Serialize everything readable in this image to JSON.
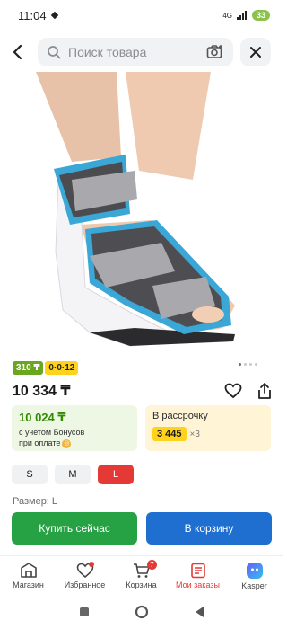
{
  "status": {
    "time": "11:04",
    "network": "4G",
    "battery": "33"
  },
  "search": {
    "placeholder": "Поиск товара"
  },
  "badges": {
    "bonus": "310 ₸",
    "installment": "0·0·12"
  },
  "product": {
    "price": "10 334 ₸"
  },
  "bonus_card": {
    "price": "10 024 ₸",
    "line1": "с учетом Бонусов",
    "line2": "при оплате"
  },
  "installment_card": {
    "title": "В рассрочку",
    "amount": "3 445",
    "multiplier": "×3"
  },
  "sizes": {
    "options": [
      "S",
      "M",
      "L"
    ],
    "selected": "L",
    "label": "Размер: L"
  },
  "actions": {
    "buy_now": "Купить сейчас",
    "to_cart": "В корзину"
  },
  "nav": {
    "items": [
      {
        "label": "Магазин",
        "icon": "store-icon"
      },
      {
        "label": "Избранное",
        "icon": "heart-icon"
      },
      {
        "label": "Корзина",
        "icon": "cart-icon",
        "badge": "7"
      },
      {
        "label": "Мои заказы",
        "icon": "orders-icon"
      },
      {
        "label": "Kasper",
        "icon": "kasper-icon"
      }
    ],
    "active": "Мои заказы"
  },
  "colors": {
    "accent_red": "#e53935",
    "buy_green": "#26a244",
    "cart_blue": "#1e6fcf"
  }
}
